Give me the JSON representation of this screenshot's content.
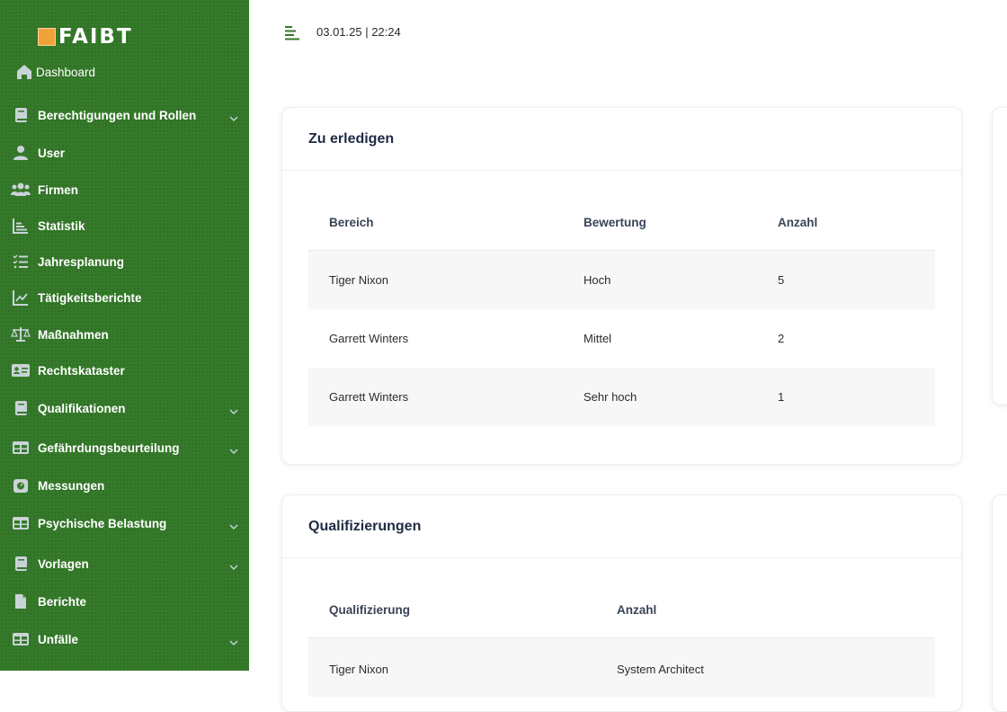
{
  "brand": {
    "logo_text": "FAIBT",
    "accent": "#f0a23a",
    "sidebar_bg": "#357a2a"
  },
  "sidebar": {
    "dashboard": {
      "label": "Dashboard",
      "icon": "home-icon"
    },
    "items": [
      {
        "label": "Berechtigungen und Rollen",
        "icon": "book-icon",
        "chevron": true
      },
      {
        "label": "User",
        "icon": "user-icon",
        "chevron": false
      },
      {
        "label": "Firmen",
        "icon": "users-icon",
        "chevron": false
      },
      {
        "label": "Statistik",
        "icon": "bar-chart-icon",
        "chevron": false
      },
      {
        "label": "Jahresplanung",
        "icon": "checklist-icon",
        "chevron": false
      },
      {
        "label": "Tätigkeitsberichte",
        "icon": "line-chart-icon",
        "chevron": false
      },
      {
        "label": "Maßnahmen",
        "icon": "balance-scale-icon",
        "chevron": false
      },
      {
        "label": "Rechtskataster",
        "icon": "id-card-icon",
        "chevron": false
      },
      {
        "label": "Qualifikationen",
        "icon": "book-icon",
        "chevron": true
      },
      {
        "label": "Gefährdungsbeurteilung",
        "icon": "table-icon",
        "chevron": true
      },
      {
        "label": "Messungen",
        "icon": "gauge-icon",
        "chevron": false
      },
      {
        "label": "Psychische Belastung",
        "icon": "table-icon",
        "chevron": true
      },
      {
        "label": "Vorlagen",
        "icon": "book-icon",
        "chevron": true
      },
      {
        "label": "Berichte",
        "icon": "file-icon",
        "chevron": false
      },
      {
        "label": "Unfälle",
        "icon": "table-icon",
        "chevron": true
      }
    ]
  },
  "topbar": {
    "datetime": "03.01.25 | 22:24",
    "menu_icon": "menu-lines-icon"
  },
  "todo": {
    "title": "Zu erledigen",
    "columns": [
      "Bereich",
      "Bewertung",
      "Anzahl"
    ],
    "rows": [
      [
        "Tiger Nixon",
        "Hoch",
        "5"
      ],
      [
        "Garrett Winters",
        "Mittel",
        "2"
      ],
      [
        "Garrett Winters",
        "Sehr hoch",
        "1"
      ]
    ]
  },
  "qual": {
    "title": "Qualifizierungen",
    "columns": [
      "Qualifizierung",
      "Anzahl"
    ],
    "rows": [
      [
        "Tiger Nixon",
        "System Architect"
      ]
    ]
  }
}
